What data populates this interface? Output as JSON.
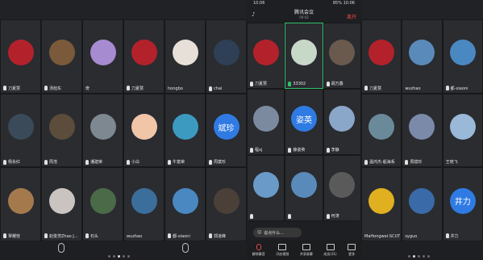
{
  "left_panel": {
    "rows": [
      [
        {
          "name": "刀夏慧",
          "color": "#b3222b"
        },
        {
          "name": "汤旭东",
          "color": "#7a5a3a"
        },
        {
          "name": "奇",
          "color": "#a68bd0",
          "nomic": true
        },
        {
          "name": "刀夏慧",
          "color": "#b3222b"
        },
        {
          "name": "hongbo",
          "color": "#e7e0d8",
          "nomic": true
        },
        {
          "name": "chai",
          "color": "#2f3f55"
        }
      ],
      [
        {
          "name": "杨永红",
          "color": "#3a4a58"
        },
        {
          "name": "周浩",
          "color": "#5c4c3c"
        },
        {
          "name": "潘建荣",
          "color": "#7e8890"
        },
        {
          "name": "小白",
          "color": "#f1c6a8"
        },
        {
          "name": "牛富荣",
          "color": "#3c9ac0"
        },
        {
          "name": "周斌珍",
          "color": "#2f7be3",
          "text": "斌珍"
        }
      ],
      [
        {
          "name": "覃耀桂",
          "color": "#a47a4c"
        },
        {
          "name": "赵俊茨Zhao J...",
          "color": "#c9c4c0"
        },
        {
          "name": "石头",
          "color": "#4a6a48"
        },
        {
          "name": "wuzhao",
          "color": "#3b6e9a",
          "nomic": true
        },
        {
          "name": "都-xiaoni",
          "color": "#4a88c2"
        },
        {
          "name": "郭凌峰",
          "color": "#4b4038"
        }
      ]
    ],
    "dots": [
      false,
      false,
      true,
      false,
      false
    ]
  },
  "phone": {
    "status_left": "10:06",
    "status_right": "85% 10:06",
    "title": "腾讯会议",
    "subtitle": "00:42",
    "leave": "离开",
    "rows": [
      [
        {
          "name": "刀夏慧",
          "color": "#b3222b"
        },
        {
          "name": "33302",
          "color": "#c8d8c8",
          "active": true
        },
        {
          "name": "胡万鑫",
          "color": "#6a5a4e"
        }
      ],
      [
        {
          "name": "程xj",
          "color": "#7c8aa0"
        },
        {
          "name": "薛姿英",
          "color": "#2f7be3",
          "text": "姿英"
        },
        {
          "name": "李静",
          "color": "#8aa6c8"
        }
      ],
      [
        {
          "name": "",
          "color": "#6a9bc8"
        },
        {
          "name": "",
          "color": "#5a8aba"
        },
        {
          "name": "何涛",
          "color": "#5a5a5a"
        }
      ]
    ],
    "chat_placeholder": "说点什么...",
    "toolbar": [
      {
        "label": "解除静音",
        "icon": "mic-off-icon"
      },
      {
        "label": "开启视频",
        "icon": "video-off-icon"
      },
      {
        "label": "共享屏幕",
        "icon": "screen-share-icon"
      },
      {
        "label": "成员(31)",
        "icon": "members-icon"
      },
      {
        "label": "更多",
        "icon": "more-icon"
      }
    ]
  },
  "right_panel": {
    "rows": [
      [
        {
          "name": "刀夏慧",
          "color": "#b3222b"
        },
        {
          "name": "wuzhao",
          "color": "#5a8aba",
          "nomic": true
        },
        {
          "name": "都-xiaoni",
          "color": "#4a88c2"
        }
      ],
      [
        {
          "name": "温鸿杰-船海系",
          "color": "#6a8a9a"
        },
        {
          "name": "周斌珍",
          "color": "#7a8aa8"
        },
        {
          "name": "王晓飞",
          "color": "#9ab8d8",
          "nomic": true
        }
      ],
      [
        {
          "name": "MaHongwei-SCUT",
          "color": "#e0b020",
          "nomic": true
        },
        {
          "name": "syguo",
          "color": "#3a6aa8",
          "nomic": true
        },
        {
          "name": "井力",
          "color": "#2f7be3",
          "text": "井力"
        }
      ]
    ],
    "dots": [
      false,
      true,
      false,
      false,
      false
    ]
  }
}
